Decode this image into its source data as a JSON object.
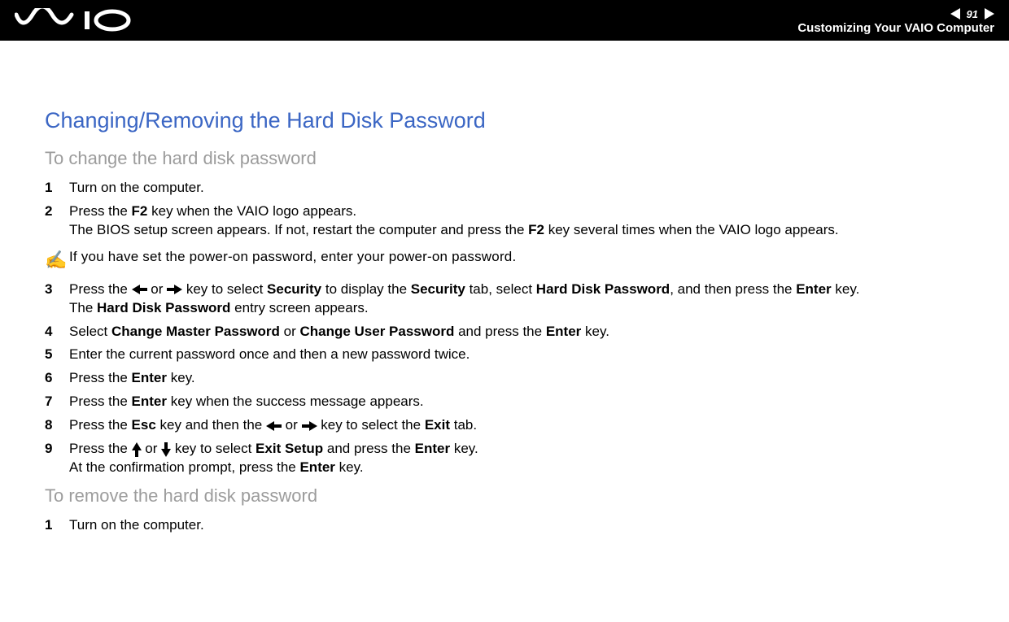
{
  "header": {
    "page_number": "91",
    "section": "Customizing Your VAIO Computer"
  },
  "title": "Changing/Removing the Hard Disk Password",
  "section1": {
    "subtitle": "To change the hard disk password",
    "steps": {
      "s1": "Turn on the computer.",
      "s2a": "Press the ",
      "s2b": " key when the VAIO logo appears.",
      "s2c": "The BIOS setup screen appears. If not, restart the computer and press the ",
      "s2d": " key several times when the VAIO logo appears.",
      "callout": "If you have set the power-on password, enter your power-on password.",
      "s3a": "Press the ",
      "s3b": " or ",
      "s3c": " key to select ",
      "s3d": " to display the ",
      "s3e": " tab, select ",
      "s3f": ", and then press the ",
      "s3g": " key.",
      "s3h": "The ",
      "s3i": " entry screen appears.",
      "s4a": "Select ",
      "s4b": " or ",
      "s4c": " and press the ",
      "s4d": " key.",
      "s5": "Enter the current password once and then a new password twice.",
      "s6a": "Press the ",
      "s6b": " key.",
      "s7a": "Press the ",
      "s7b": " key when the success message appears.",
      "s8a": "Press the ",
      "s8b": " key and then the ",
      "s8c": " or ",
      "s8d": " key to select the ",
      "s8e": " tab.",
      "s9a": "Press the ",
      "s9b": " or ",
      "s9c": " key to select ",
      "s9d": " and press the ",
      "s9e": " key.",
      "s9f": "At the confirmation prompt, press the ",
      "s9g": " key."
    },
    "bold": {
      "F2": "F2",
      "Security": "Security",
      "HardDiskPassword": "Hard Disk Password",
      "Enter": "Enter",
      "ChangeMaster": "Change Master Password",
      "ChangeUser": "Change User Password",
      "Esc": "Esc",
      "Exit": "Exit",
      "ExitSetup": "Exit Setup"
    }
  },
  "section2": {
    "subtitle": "To remove the hard disk password",
    "steps": {
      "s1": "Turn on the computer."
    }
  },
  "numbers": {
    "n1": "1",
    "n2": "2",
    "n3": "3",
    "n4": "4",
    "n5": "5",
    "n6": "6",
    "n7": "7",
    "n8": "8",
    "n9": "9"
  }
}
